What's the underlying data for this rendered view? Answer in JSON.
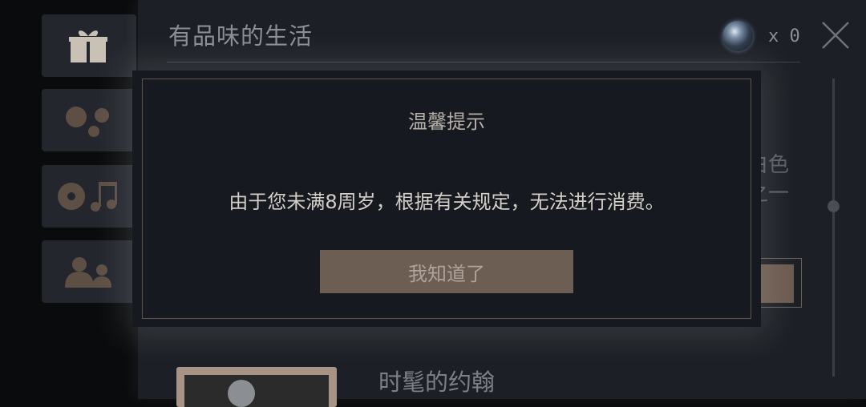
{
  "tabs": [
    {
      "name": "tab-gift",
      "icon": "gift-icon"
    },
    {
      "name": "tab-circles",
      "icon": "circles-icon"
    },
    {
      "name": "tab-music",
      "icon": "music-icon"
    },
    {
      "name": "tab-people",
      "icon": "people-icon"
    }
  ],
  "panel": {
    "title": "有品味的生活",
    "coin_count": "x 0",
    "peek_text": [
      "白色",
      "之一"
    ],
    "item_title": "时髦的约翰"
  },
  "modal": {
    "title": "温馨提示",
    "message": "由于您未满8周岁，根据有关规定，无法进行消费。",
    "button_label": "我知道了"
  },
  "colors": {
    "accent": "#6d5e53",
    "frame": "#5e5548"
  }
}
